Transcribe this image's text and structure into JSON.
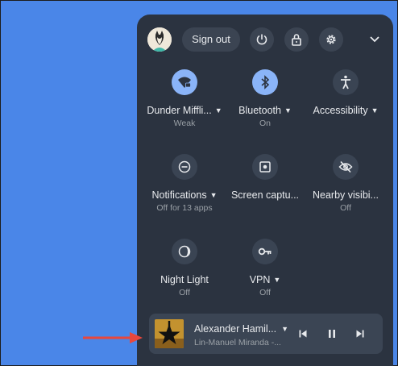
{
  "header": {
    "sign_out_label": "Sign out"
  },
  "icons": {
    "avatar": "user-avatar",
    "power": "power-icon",
    "lock": "lock-icon",
    "settings": "gear-icon",
    "collapse": "chevron-down-icon"
  },
  "tiles": [
    {
      "label": "Dunder Miffli...",
      "sub": "Weak",
      "icon": "wifi-icon",
      "active": true,
      "dropdown": true
    },
    {
      "label": "Bluetooth",
      "sub": "On",
      "icon": "bluetooth-icon",
      "active": true,
      "dropdown": true
    },
    {
      "label": "Accessibility",
      "sub": "",
      "icon": "accessibility-icon",
      "active": false,
      "dropdown": true
    },
    {
      "label": "Notifications",
      "sub": "Off for 13 apps",
      "icon": "do-not-disturb-icon",
      "active": false,
      "dropdown": true
    },
    {
      "label": "Screen captu...",
      "sub": "",
      "icon": "screen-capture-icon",
      "active": false,
      "dropdown": false
    },
    {
      "label": "Nearby visibi...",
      "sub": "Off",
      "icon": "visibility-off-icon",
      "active": false,
      "dropdown": false
    },
    {
      "label": "Night Light",
      "sub": "Off",
      "icon": "night-light-icon",
      "active": false,
      "dropdown": false
    },
    {
      "label": "VPN",
      "sub": "Off",
      "icon": "vpn-key-icon",
      "active": false,
      "dropdown": true
    }
  ],
  "media": {
    "title": "Alexander Hamil...",
    "artist": "Lin-Manuel Miranda -...",
    "controls": [
      "previous-track-icon",
      "pause-icon",
      "next-track-icon"
    ]
  },
  "annotation": {
    "arrow_color": "#e8473c"
  },
  "colors": {
    "desktop": "#4a86e8",
    "panel": "#2b3340",
    "active_tile": "#8ab4f8"
  }
}
